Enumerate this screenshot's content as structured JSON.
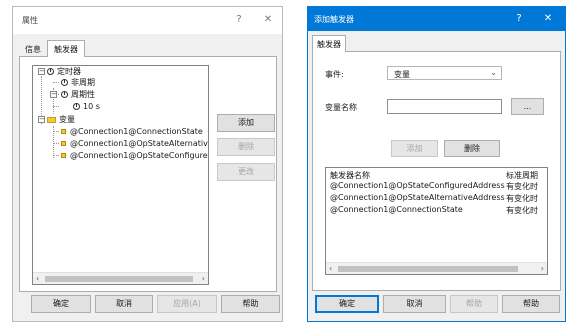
{
  "dialog1": {
    "title": "属性",
    "help_glyph": "?",
    "close_glyph": "✕",
    "tabs": [
      "信息",
      "触发器"
    ],
    "tree": {
      "expander_minus": "−",
      "timer": "定时器",
      "aperiodic": "非周期",
      "periodic": "周期性",
      "period_value": "10 s",
      "variables": "变量",
      "vars": [
        "@Connection1@ConnectionState",
        "@Connection1@OpStateAlternativeA",
        "@Connection1@OpStateConfiguredA"
      ]
    },
    "scroll_left": "‹",
    "scroll_right": "›",
    "side_buttons": {
      "add": "添加",
      "delete": "删除",
      "change": "更改"
    },
    "footer": {
      "ok": "确定",
      "cancel": "取消",
      "apply": "应用(A)",
      "help": "帮助"
    }
  },
  "dialog2": {
    "title": "添加触发器",
    "help_glyph": "?",
    "close_glyph": "✕",
    "tab": "触发器",
    "event_label": "事件:",
    "event_value": "变量",
    "event_chevron": "⌄",
    "var_label": "变量名称",
    "var_value": "",
    "browse": "...",
    "add": "添加",
    "delete": "删除",
    "list_headers": [
      "触发器名称",
      "标准周期"
    ],
    "list_rows": [
      [
        "@Connection1@OpStateConfiguredAddress",
        "有变化时"
      ],
      [
        "@Connection1@OpStateAlternativeAddress",
        "有变化时"
      ],
      [
        "@Connection1@ConnectionState",
        "有变化时"
      ]
    ],
    "scroll_left": "‹",
    "scroll_right": "›",
    "footer": {
      "ok": "确定",
      "cancel": "取消",
      "help_partial": "帮助",
      "help": "帮助"
    }
  },
  "colors": {
    "accent": "#0078d7",
    "dialog_bg": "#f0f0f0",
    "folder": "#f3c93c"
  }
}
